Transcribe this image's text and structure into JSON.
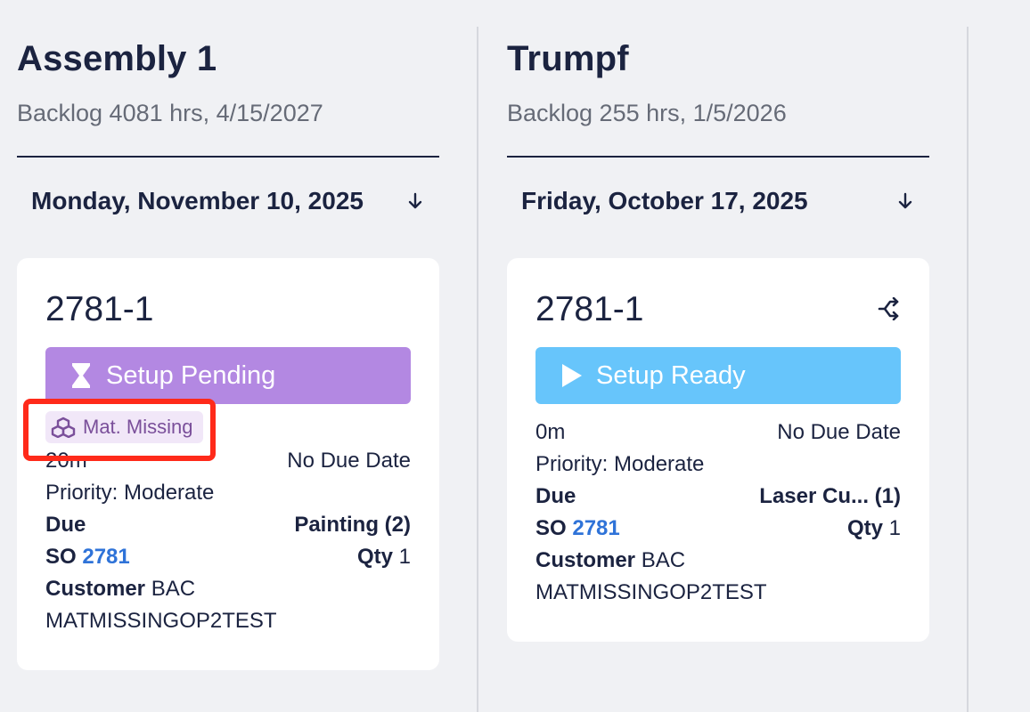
{
  "columns": [
    {
      "title": "Assembly 1",
      "backlog": "Backlog 4081 hrs, 4/15/2027",
      "date": "Monday, November 10, 2025",
      "card": {
        "job_number": "2781-1",
        "status": "Setup Pending",
        "status_color": "#b388e2",
        "status_icon": "hourglass-icon",
        "badge": "Mat. Missing",
        "badge_icon": "boxes-icon",
        "duration": "20m",
        "due_date": "No Due Date",
        "priority": "Priority: Moderate",
        "due_label": "Due",
        "operation": "Painting (2)",
        "so_label": "SO",
        "so_number": "2781",
        "qty_label": "Qty",
        "qty": "1",
        "customer_label": "Customer",
        "customer": "BAC",
        "part": "MATMISSINGOP2TEST"
      }
    },
    {
      "title": "Trumpf",
      "backlog": "Backlog 255 hrs, 1/5/2026",
      "date": "Friday, October 17, 2025",
      "card": {
        "job_number": "2781-1",
        "status": "Setup Ready",
        "status_color": "#67c5fb",
        "status_icon": "play-icon",
        "duration": "0m",
        "due_date": "No Due Date",
        "priority": "Priority: Moderate",
        "due_label": "Due",
        "operation": "Laser Cu... (1)",
        "so_label": "SO",
        "so_number": "2781",
        "qty_label": "Qty",
        "qty": "1",
        "customer_label": "Customer",
        "customer": "BAC",
        "part": "MATMISSINGOP2TEST"
      }
    }
  ]
}
